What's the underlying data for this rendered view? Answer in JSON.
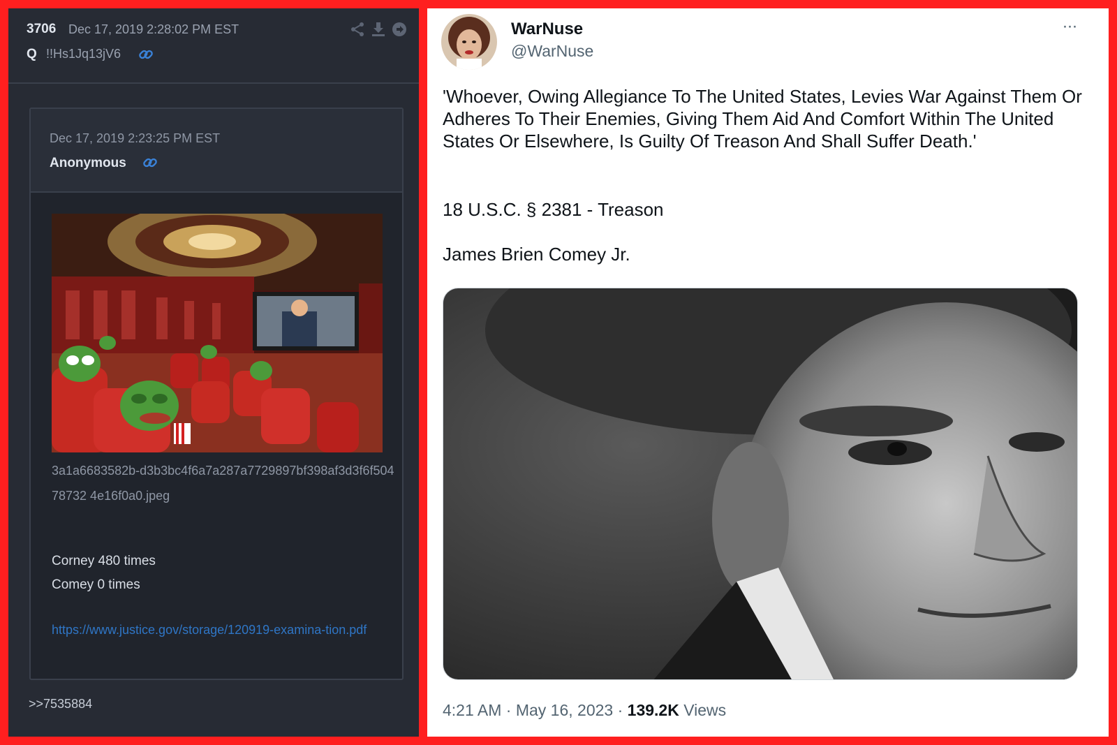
{
  "q_drop": {
    "number": "3706",
    "timestamp": "Dec 17, 2019 2:28:02 PM EST",
    "author": "Q",
    "tripcode": "!!Hs1Jq13jV6",
    "header_icons": [
      "share-icon",
      "download-icon",
      "arrow-right-circle-icon"
    ],
    "quoted_post": {
      "timestamp": "Dec 17, 2019 2:23:25 PM EST",
      "author": "Anonymous",
      "image_filename": "3a1a6683582b-d3b3bc4f6a7a287a7729897bf398af3d3f6f50478732 4e16f0a0.jpeg",
      "line1": "Corney 480 times",
      "line2": "Comey 0 times",
      "link": "https://www.justice.gov/storage/120919-examina-tion.pdf"
    },
    "reply_ref": ">>7535884"
  },
  "tweet": {
    "display_name": "WarNuse",
    "handle": "@WarNuse",
    "more_label": "···",
    "text": {
      "paragraph1": "'Whoever, Owing Allegiance To The United States, Levies War Against Them Or Adheres To Their Enemies, Giving Them Aid And Comfort Within The United States Or Elsewhere, Is Guilty Of Treason And Shall Suffer Death.'",
      "paragraph2": "18 U.S.C. § 2381 - Treason",
      "paragraph3": "James Brien Comey Jr."
    },
    "meta": {
      "time": "4:21 AM",
      "separator1": " · ",
      "date": "May 16, 2023",
      "separator2": " · ",
      "views_count": "139.2K",
      "views_label": " Views"
    }
  },
  "colors": {
    "frame_red": "#ff1f1f",
    "left_bg": "#272b34",
    "link_blue": "#2f76c6",
    "tweet_gray": "#536471"
  }
}
